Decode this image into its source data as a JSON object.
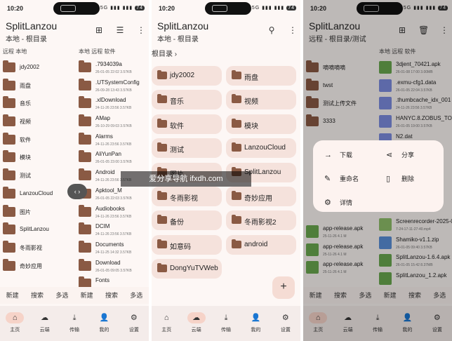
{
  "status": {
    "time": "10:20",
    "signal": "5G ▮▮▮ ▮▮▮",
    "battery": "74"
  },
  "phone1": {
    "title": "SplitLanzou",
    "subtitle": "本地 - 根目录",
    "left_labels": "远程 本地",
    "right_labels": "本地 远程 软件",
    "left_items": [
      "jdy2002",
      "雨盘",
      "音乐",
      "视频",
      "软件",
      "模块",
      "测试",
      "LanzouCloud",
      "图片",
      "SplitLanzou",
      "冬雨影视",
      "奇妙应用"
    ],
    "right_items": [
      {
        "name": ".7934039a",
        "meta": "26-01-05 22:02 3.57KB"
      },
      {
        "name": ".UTSystemConfig",
        "meta": "26-09-28 13:43 3.57KB"
      },
      {
        "name": ".xlDownload",
        "meta": "24-11-26 23:56 3.57KB"
      },
      {
        "name": "AMap",
        "meta": "26-10-29 09:03 3.57KB"
      },
      {
        "name": "Alarms",
        "meta": "24-11-26 23:56 3.57KB"
      },
      {
        "name": "AliYunPan",
        "meta": "26-01-05 23:00 3.57KB"
      },
      {
        "name": "Android",
        "meta": "24-11-26 23:56 3.57KB"
      },
      {
        "name": "Apktool_M",
        "meta": "26-01-05 22:03 3.57KB"
      },
      {
        "name": "Audiobooks",
        "meta": "24-11-26 23:56 3.57KB"
      },
      {
        "name": "DCIM",
        "meta": "24-11-26 23:56 3.57KB"
      },
      {
        "name": "Documents",
        "meta": "24-11-25 14:32 3.57KB"
      },
      {
        "name": "Download",
        "meta": "26-01-05 09:05 3.57KB"
      },
      {
        "name": "Fonts",
        "meta": ""
      }
    ],
    "actions": [
      "新建",
      "搜索",
      "多选",
      "新建",
      "搜索",
      "多选"
    ]
  },
  "phone2": {
    "title": "SplitLanzou",
    "subtitle": "本地 - 根目录",
    "breadcrumb": "根目录",
    "folders": [
      "jdy2002",
      "雨盘",
      "音乐",
      "视频",
      "软件",
      "模块",
      "测试",
      "LanzouCloud",
      "图片",
      "SplitLanzou",
      "冬雨影视",
      "奇妙应用",
      "备份",
      "冬雨影视2",
      "如意码",
      "android",
      "DongYuTVWeb"
    ],
    "fab": "+"
  },
  "phone3": {
    "title": "SplitLanzou",
    "subtitle": "远程 - 根目录/测试",
    "right_labels": "本地 远程 软件",
    "left_items": [
      "嘀嘀嘀嘀",
      "twst",
      "测试上传文件",
      "3333"
    ],
    "left_bottom": [
      {
        "name": "app-release.apk",
        "meta": "25-11-26 4.1 M"
      },
      {
        "name": "app-release.apk",
        "meta": "25-11-26 4.1 M"
      },
      {
        "name": "app-release.apk",
        "meta": "25-11-26 4.1 M"
      }
    ],
    "right_items": [
      {
        "name": "3djent_70421.apk",
        "meta": "26-01-08 17:00 3.00MB"
      },
      {
        "name": ".exmu-cfg1.data",
        "meta": "26-01-05 22:04 3.57KB"
      },
      {
        "name": ".thumbcache_idx_001",
        "meta": "24-11-26 23:56 3.57KB"
      },
      {
        "name": "HANYC.8.ZOBUS_TOKE",
        "meta": "26-01-05 19:00 3.57KB"
      },
      {
        "name": "N2.dat",
        "meta": ""
      }
    ],
    "right_bottom": [
      {
        "name": "Screenrecorder-2025-0",
        "meta": "7-24-17-11-27-40.mp4"
      },
      {
        "name": "Shamiko-v1.1.zip",
        "meta": "26-01-05 09:40 3.57KB"
      },
      {
        "name": "SplitLanzou-1.6.4.apk",
        "meta": "26-01-05 15:42 8.37MB"
      },
      {
        "name": "SplitLanzou_1.2.apk",
        "meta": ""
      }
    ],
    "menu": {
      "download": "下载",
      "share": "分享",
      "rename": "重命名",
      "delete": "删除",
      "details": "详情"
    }
  },
  "nav": [
    "主页",
    "云端",
    "传输",
    "我的",
    "设置"
  ],
  "watermark": "爱分享导航 ifxdh.com"
}
